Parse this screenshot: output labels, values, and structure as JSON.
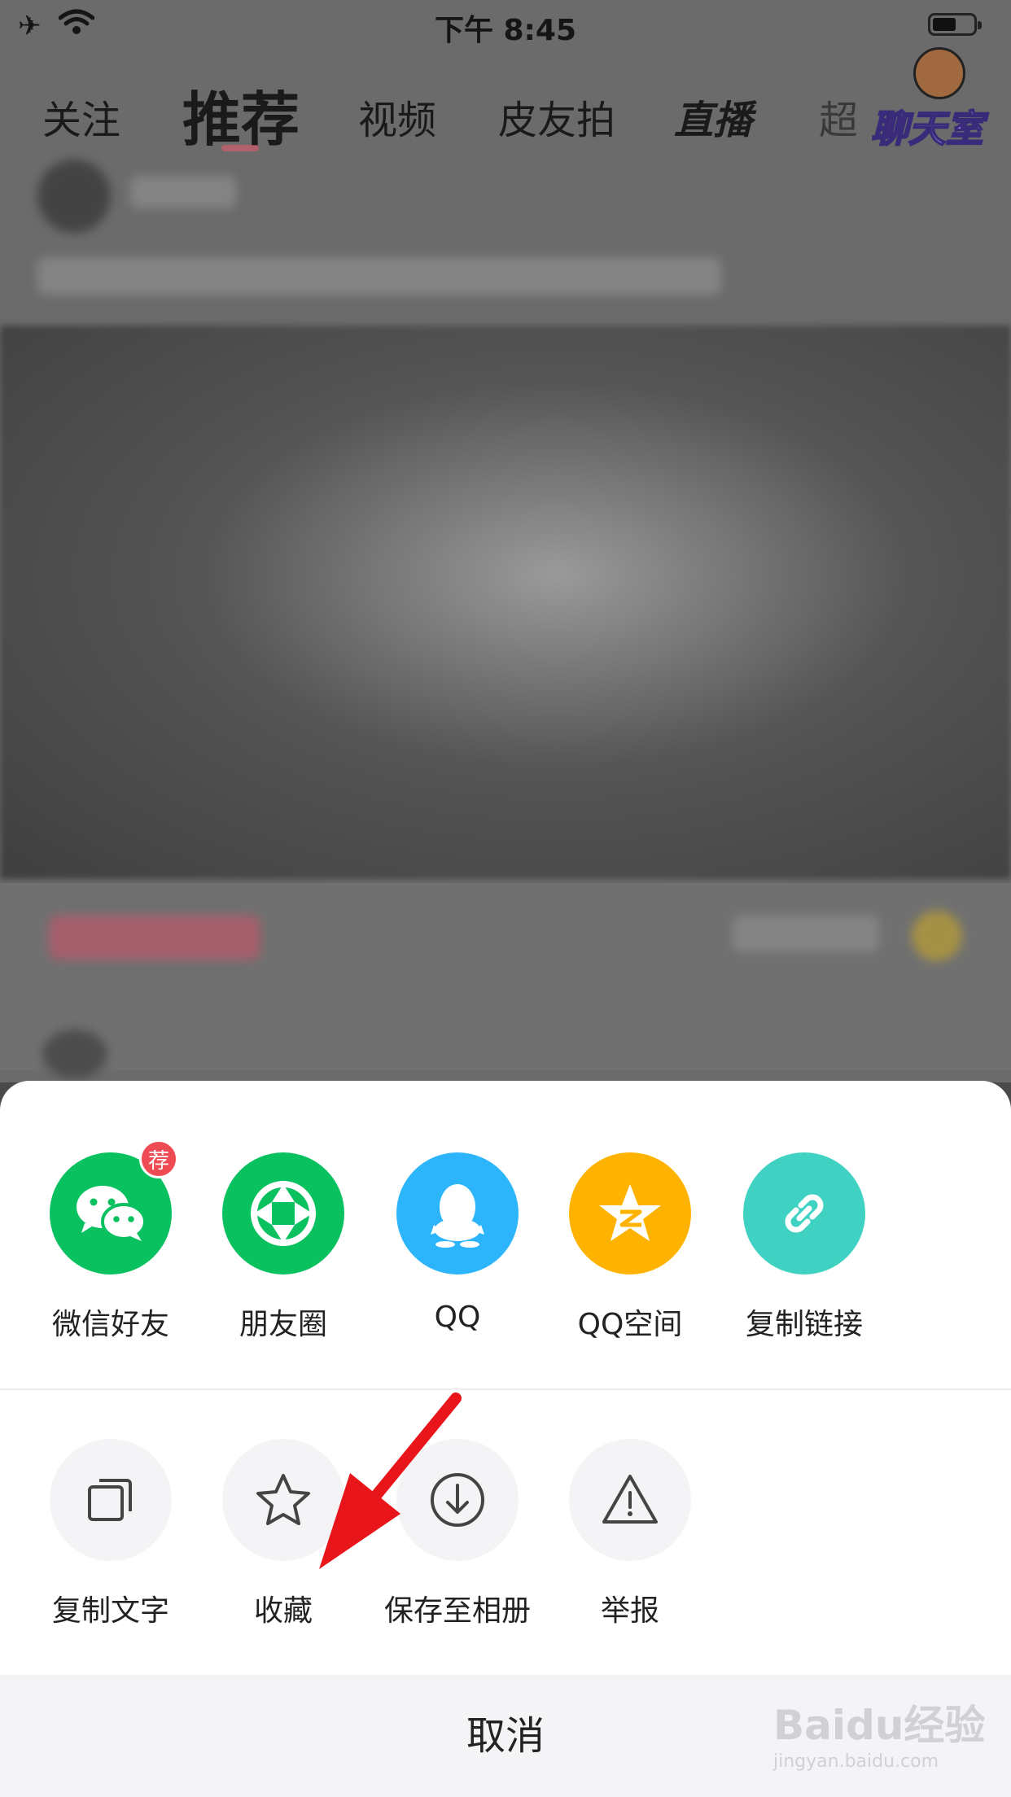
{
  "status_bar": {
    "time": "下午 8:45"
  },
  "top_tabs": [
    {
      "label": "关注",
      "key": "follow"
    },
    {
      "label": "推荐",
      "key": "recommend"
    },
    {
      "label": "视频",
      "key": "video"
    },
    {
      "label": "皮友拍",
      "key": "pyp"
    },
    {
      "label": "直播",
      "key": "live"
    },
    {
      "label": "超",
      "key": "more"
    }
  ],
  "chatroom_badge": {
    "label": "聊天室"
  },
  "share_row": [
    {
      "label": "微信好友",
      "icon": "wechat-icon",
      "color": "#09c25f",
      "badge": "荐"
    },
    {
      "label": "朋友圈",
      "icon": "moments-icon",
      "color": "#09c25f"
    },
    {
      "label": "QQ",
      "icon": "qq-icon",
      "color": "#2cb5fb"
    },
    {
      "label": "QQ空间",
      "icon": "qzone-icon",
      "color": "#ffb300"
    },
    {
      "label": "复制链接",
      "icon": "link-icon",
      "color": "#3fd1c2"
    }
  ],
  "action_row": [
    {
      "label": "复制文字",
      "icon": "copy-icon"
    },
    {
      "label": "收藏",
      "icon": "star-icon"
    },
    {
      "label": "保存至相册",
      "icon": "download-icon"
    },
    {
      "label": "举报",
      "icon": "warning-icon"
    }
  ],
  "cancel_label": "取消",
  "watermark": {
    "logo": "Baidu经验",
    "url": "jingyan.baidu.com"
  }
}
